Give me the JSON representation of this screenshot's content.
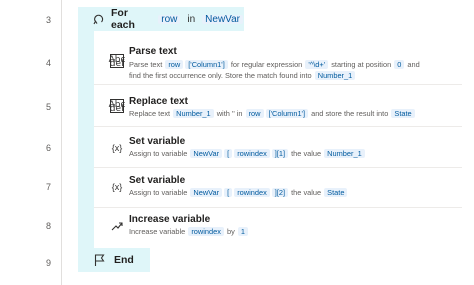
{
  "line_numbers": [
    "3",
    "4",
    "5",
    "6",
    "7",
    "8",
    "9"
  ],
  "foreach": {
    "title": "For each",
    "var": "row",
    "in_label": "in",
    "collection": "NewVar"
  },
  "actions": [
    {
      "icon": "parse-text-icon",
      "icon_text": "Abc def",
      "title": "Parse text",
      "desc_line1": [
        "Parse text ",
        {
          "tok": "row"
        },
        {
          "tok": "['Column1']"
        },
        " for regular expression ",
        {
          "tok": "'^\\d+'"
        },
        " starting at position ",
        {
          "tok": "0"
        },
        " and"
      ],
      "desc_line2": [
        "find the first occurrence only. Store the match found into ",
        {
          "tok": "Number_1"
        }
      ]
    },
    {
      "icon": "replace-text-icon",
      "icon_text": "Abc def",
      "title": "Replace text",
      "desc_line1": [
        "Replace text ",
        {
          "tok": "Number_1"
        },
        " with '' in ",
        {
          "tok": "row"
        },
        {
          "tok": "['Column1']"
        },
        " and store the result into ",
        {
          "tok": "State"
        }
      ]
    },
    {
      "icon": "variable-icon",
      "icon_text": "{x}",
      "title": "Set variable",
      "desc_line1": [
        "Assign to variable ",
        {
          "tok": "NewVar"
        },
        {
          "tok": "["
        },
        {
          "tok": "rowindex"
        },
        {
          "tok": "][1]"
        },
        " the value ",
        {
          "tok": "Number_1"
        }
      ]
    },
    {
      "icon": "variable-icon",
      "icon_text": "{x}",
      "title": "Set variable",
      "desc_line1": [
        "Assign to variable ",
        {
          "tok": "NewVar"
        },
        {
          "tok": "["
        },
        {
          "tok": "rowindex"
        },
        {
          "tok": "][2]"
        },
        " the value ",
        {
          "tok": "State"
        }
      ]
    },
    {
      "icon": "increase-variable-icon",
      "icon_text": "",
      "title": "Increase variable",
      "desc_line1": [
        "Increase variable ",
        {
          "tok": "rowindex"
        },
        " by ",
        {
          "tok": "1"
        }
      ]
    }
  ],
  "end": {
    "title": "End"
  }
}
